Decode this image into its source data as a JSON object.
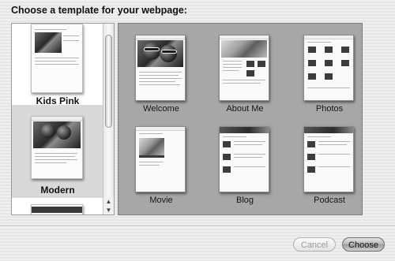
{
  "dialog": {
    "heading": "Choose a template for your webpage:"
  },
  "templates": [
    "Kids Pink",
    "Modern"
  ],
  "selected_template": "Modern",
  "page_types": [
    "Welcome",
    "About Me",
    "Photos",
    "Movie",
    "Blog",
    "Podcast"
  ],
  "buttons": {
    "cancel": "Cancel",
    "choose": "Choose"
  }
}
